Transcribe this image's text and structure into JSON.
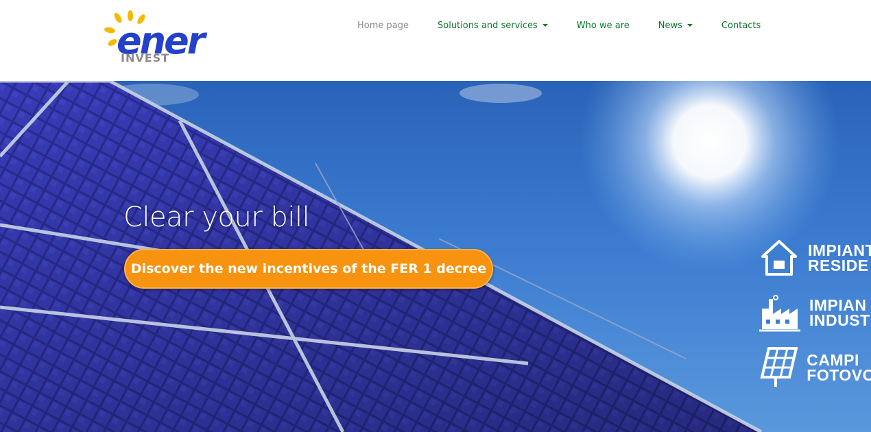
{
  "logo": {
    "word": "ener",
    "sub": "INVEST"
  },
  "nav": {
    "items": [
      {
        "label": "Home page",
        "dropdown": false,
        "active": true
      },
      {
        "label": "Solutions and services",
        "dropdown": true,
        "active": false
      },
      {
        "label": "Who we are",
        "dropdown": false,
        "active": false
      },
      {
        "label": "News",
        "dropdown": true,
        "active": false
      },
      {
        "label": "Contacts",
        "dropdown": false,
        "active": false
      }
    ]
  },
  "hero": {
    "title": "Clear your bill",
    "cta_label": "Discover the new incentives of the FER 1 decree"
  },
  "side_links": [
    {
      "icon": "house-icon",
      "line1": "IMPIANT",
      "line2": "RESIDE"
    },
    {
      "icon": "factory-icon",
      "line1": "IMPIAN",
      "line2": "INDUST"
    },
    {
      "icon": "solar-panel-icon",
      "line1": "CAMPI",
      "line2": "FOTOVO"
    }
  ],
  "colors": {
    "nav_link": "#0a7a2a",
    "nav_active": "#888888",
    "cta_bg": "#f7930e",
    "logo_blue": "#2442c9",
    "logo_sun": "#f6b800"
  }
}
